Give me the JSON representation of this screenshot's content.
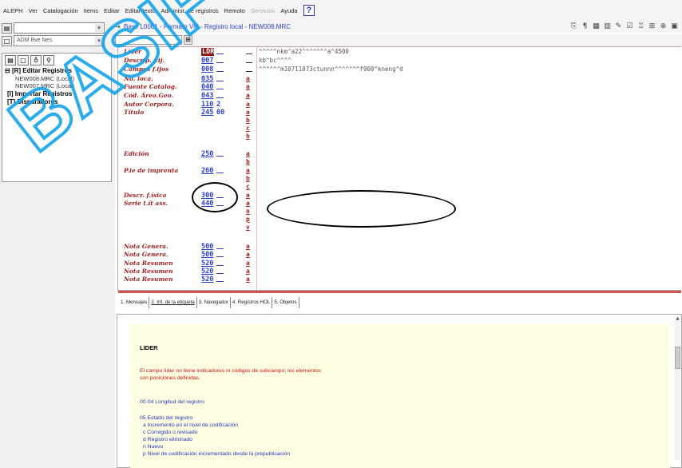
{
  "menu": [
    "ALEPH",
    "Ver",
    "Catalogación",
    "Items",
    "Editar",
    "Editar texto",
    "Administ. de registros",
    "Remoto",
    "Servicios",
    "Ayuda"
  ],
  "menu_disabled": [
    "Servicios"
  ],
  "menu_help_icon": "?",
  "left": {
    "base_combo": "ADM Bve Nes.",
    "tree": {
      "edit_group": "[R] Editar Registros",
      "records": [
        "NEW008.MRC (Local)",
        "NEW007.MRC (Local)"
      ],
      "import_group": "[I] Importar Registros",
      "triggers_group": "[T] Disparadores"
    }
  },
  "window_title": "Base L0001 - Formato VM - Registro local - NEW008.MRC",
  "editor": {
    "rows": [
      {
        "label": "Líder",
        "tag": "LDR",
        "ind": "",
        "sub": "",
        "value": "^^^^^nkm^a22^^^^^^^a^4500",
        "tag_selected": true
      },
      {
        "label": "Descrip. f.ij.",
        "tag": "007",
        "ind": "",
        "sub": "",
        "value": "kb^bc^^^^"
      },
      {
        "label": "Campos f.ijos",
        "tag": "008",
        "ind": "",
        "sub": "",
        "value": "^^^^^^m10711073ctunnn^^^^^^^f000^kneng^d"
      },
      {
        "label": "No. loca.",
        "tag": "035",
        "ind": "",
        "sub": "a",
        "value": ""
      },
      {
        "label": "Fuente Catalog.",
        "tag": "040",
        "ind": "",
        "sub": "a",
        "value": ""
      },
      {
        "label": "Cód. Área.Geo.",
        "tag": "043",
        "ind": "",
        "sub": "a",
        "value": ""
      },
      {
        "label": "Autor Corpora.",
        "tag": "110",
        "ind": "2",
        "sub": "a",
        "value": ""
      },
      {
        "label": "Título",
        "tag": "245",
        "ind": "00",
        "sub": "a",
        "value": ""
      },
      {
        "label": "",
        "tag": "",
        "ind": "",
        "sub": "b",
        "value": ""
      },
      {
        "label": "",
        "tag": "",
        "ind": "",
        "sub": "c",
        "value": ""
      },
      {
        "label": "",
        "tag": "",
        "ind": "",
        "sub": "h",
        "value": ""
      },
      {
        "label": "Edición",
        "tag": "250",
        "ind": "",
        "sub": "a",
        "value": ""
      },
      {
        "label": "",
        "tag": "",
        "ind": "",
        "sub": "b",
        "value": ""
      },
      {
        "label": "P.ie de imprenta",
        "tag": "260",
        "ind": "",
        "sub": "a",
        "value": ""
      },
      {
        "label": "",
        "tag": "",
        "ind": "",
        "sub": "b",
        "value": ""
      },
      {
        "label": "",
        "tag": "",
        "ind": "",
        "sub": "c",
        "value": ""
      },
      {
        "label": "Descr. f.ísica",
        "tag": "300",
        "ind": "",
        "sub": "a",
        "value": ""
      },
      {
        "label": "Serie t.ít ass.",
        "tag": "440",
        "ind": "",
        "sub": "a",
        "value": ""
      },
      {
        "label": "",
        "tag": "",
        "ind": "",
        "sub": "n",
        "value": ""
      },
      {
        "label": "",
        "tag": "",
        "ind": "",
        "sub": "p",
        "value": ""
      },
      {
        "label": "",
        "tag": "",
        "ind": "",
        "sub": "v",
        "value": ""
      },
      {
        "label": "Nota Genera.",
        "tag": "500",
        "ind": "",
        "sub": "a",
        "value": ""
      },
      {
        "label": "Nota Genera.",
        "tag": "500",
        "ind": "",
        "sub": "a",
        "value": ""
      },
      {
        "label": "Nota Resumen",
        "tag": "520",
        "ind": "",
        "sub": "a",
        "value": ""
      },
      {
        "label": "Nota Resumen",
        "tag": "520",
        "ind": "",
        "sub": "a",
        "value": ""
      },
      {
        "label": "Nota Resumen",
        "tag": "520",
        "ind": "",
        "sub": "a",
        "value": ""
      }
    ]
  },
  "tabs": [
    "1. Mensajes",
    "2. Inf. de la etiqueta",
    "3. Navegador",
    "4. Registros HOL",
    "5. Objetos"
  ],
  "active_tab": "2. Inf. de la etiqueta",
  "help": {
    "heading": "LIDER",
    "warning_line1": "El campo líder no tiene indicadores ni códigos de subcampo; los elementos",
    "warning_line2": "son posiciones definidas.",
    "pos1": "00-04 Longitud del registro",
    "pos2": "05 Estado del registro",
    "items": [
      "a Incremento en el nivel de codificación",
      "c Corregido o revisado",
      "d Registro eliminado",
      "n Nuevo",
      "p Nivel de codificación incrementado desde la prepublicación"
    ]
  },
  "watermark_text": "BASIF",
  "colors": {
    "label": "#9c2020",
    "tag": "#2b3fc4",
    "title": "#2a3fbf",
    "help_bg": "#ffffe4",
    "watermark": "#19a5ea"
  }
}
